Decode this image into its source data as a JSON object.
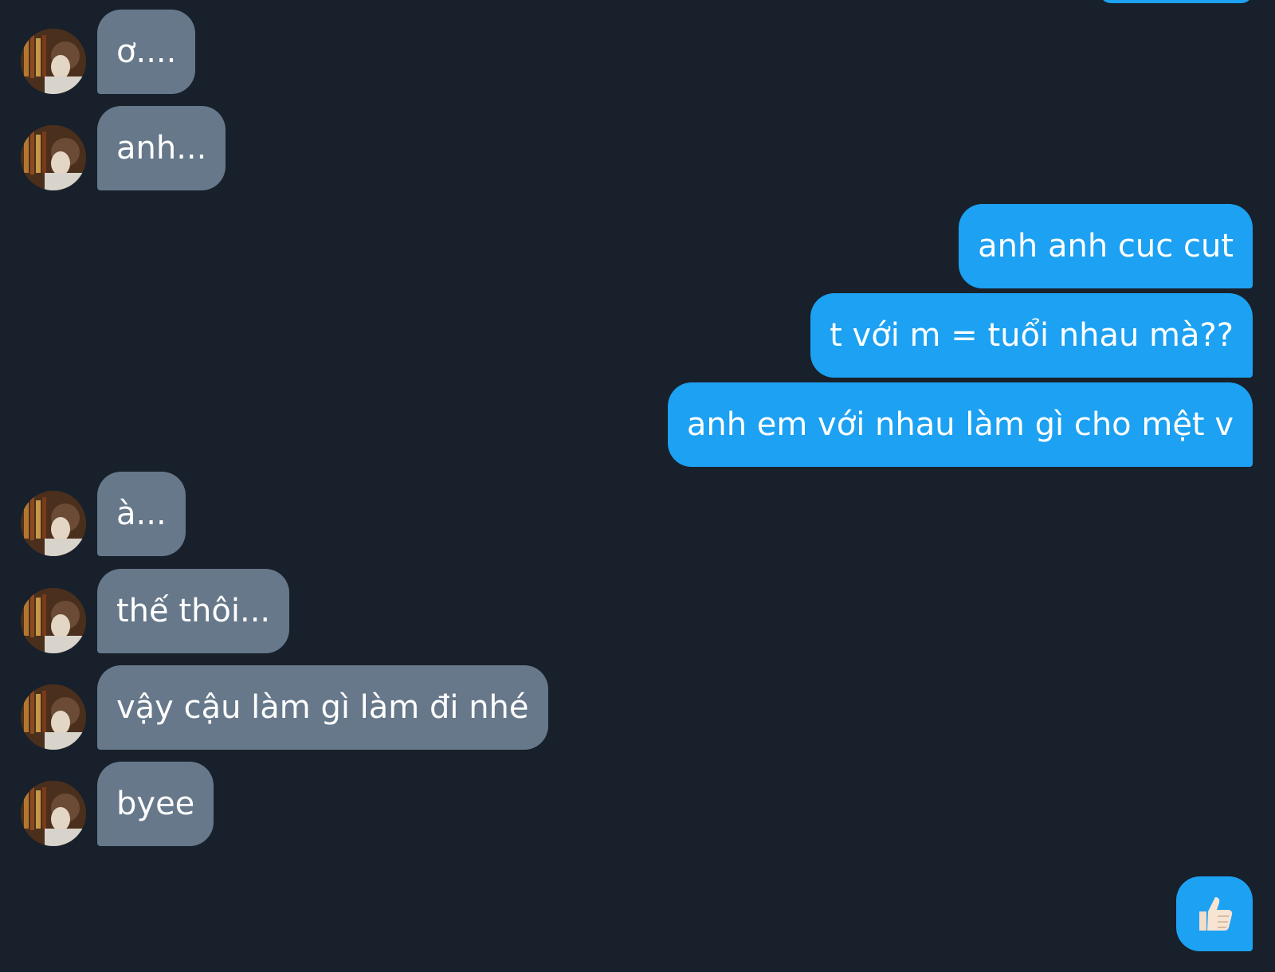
{
  "colors": {
    "background": "#17202b",
    "incoming_bubble": "#66788a",
    "outgoing_bubble": "#1da1f2",
    "text": "#ffffff"
  },
  "messages": [
    {
      "direction": "incoming",
      "text": "ơ...."
    },
    {
      "direction": "incoming",
      "text": "anh..."
    },
    {
      "direction": "outgoing",
      "text": "anh anh cuc cut"
    },
    {
      "direction": "outgoing",
      "text": "t với m = tuổi nhau mà??"
    },
    {
      "direction": "outgoing",
      "text": "anh em với nhau làm gì cho mệt v"
    },
    {
      "direction": "incoming",
      "text": "à..."
    },
    {
      "direction": "incoming",
      "text": "thế thôi..."
    },
    {
      "direction": "incoming",
      "text": "vậy cậu làm gì làm đi nhé"
    },
    {
      "direction": "incoming",
      "text": "byee"
    },
    {
      "direction": "outgoing",
      "icon": "thumbs-up-icon"
    }
  ],
  "avatar_icon": "profile-avatar"
}
